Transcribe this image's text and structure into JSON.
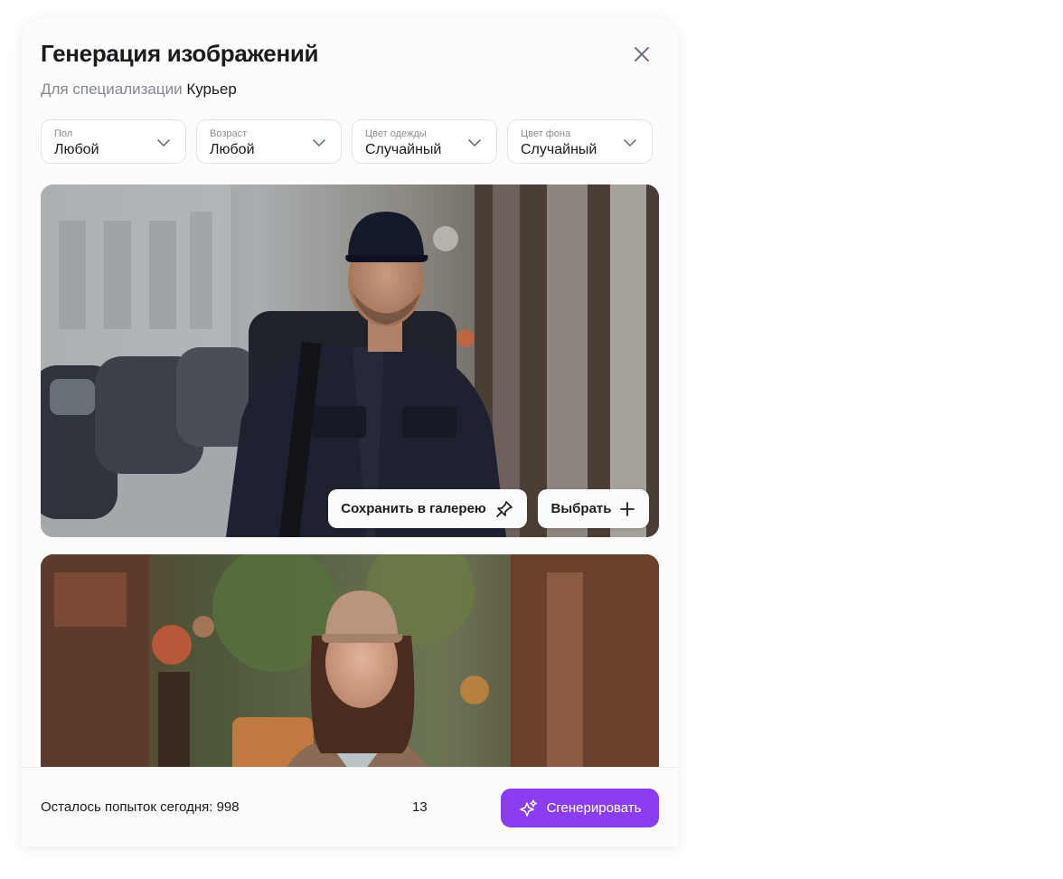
{
  "modal": {
    "title": "Генерация изображений",
    "subtitle_prefix": "Для специализации",
    "subtitle_value": "Курьер",
    "close_icon": "close-icon"
  },
  "filters": [
    {
      "label": "Пол",
      "value": "Любой"
    },
    {
      "label": "Возраст",
      "value": "Любой"
    },
    {
      "label": "Цвет одежды",
      "value": "Случайный"
    },
    {
      "label": "Цвет фона",
      "value": "Случайный"
    }
  ],
  "images": [
    {
      "description": "courier-man-with-backpack",
      "save_label": "Сохранить в галерею",
      "save_icon": "pin-icon",
      "select_label": "Выбрать",
      "select_icon": "plus-icon"
    },
    {
      "description": "courier-woman-in-cap"
    }
  ],
  "footer": {
    "attempts_text": "Осталось попыток сегодня: 998",
    "count": "13",
    "generate_label": "Сгенерировать",
    "generate_icon": "sparkle-icon"
  },
  "colors": {
    "accent": "#8b3ef0",
    "muted_text": "#7f8a96",
    "border": "#e2e1e6"
  }
}
